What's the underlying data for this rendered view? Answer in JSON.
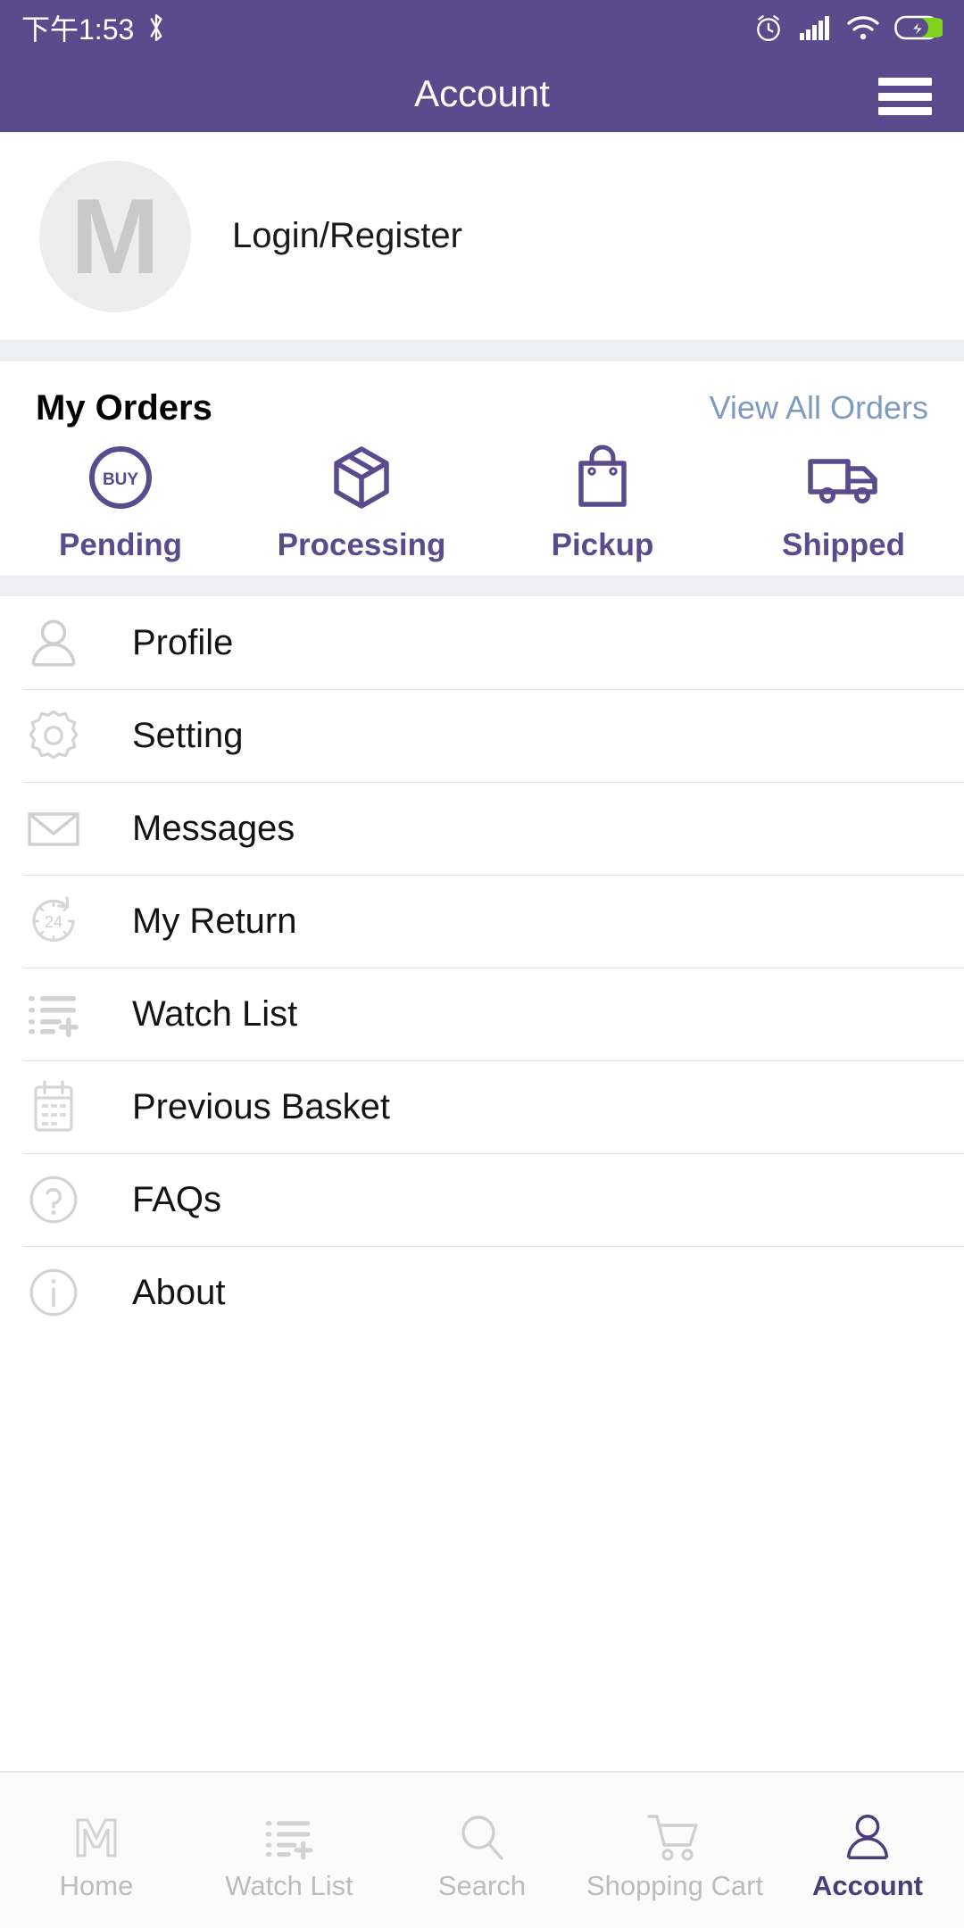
{
  "statusbar": {
    "time": "下午1:53",
    "icons": [
      "bluetooth-icon",
      "alarm-icon",
      "signal-icon",
      "wifi-icon",
      "battery-charging-icon"
    ]
  },
  "header": {
    "title": "Account",
    "menu_icon": "hamburger-menu-icon"
  },
  "profile": {
    "avatar_letter": "M",
    "login_label": "Login/Register"
  },
  "orders": {
    "title": "My Orders",
    "view_all_label": "View All Orders",
    "statuses": [
      {
        "label": "Pending",
        "icon": "buy-circle-icon"
      },
      {
        "label": "Processing",
        "icon": "package-box-icon"
      },
      {
        "label": "Pickup",
        "icon": "shopping-bag-icon"
      },
      {
        "label": "Shipped",
        "icon": "delivery-truck-icon"
      }
    ]
  },
  "menu": {
    "items": [
      {
        "label": "Profile",
        "icon": "person-icon"
      },
      {
        "label": "Setting",
        "icon": "gear-icon"
      },
      {
        "label": "Messages",
        "icon": "envelope-icon"
      },
      {
        "label": "My Return",
        "icon": "clock-24-icon"
      },
      {
        "label": "Watch List",
        "icon": "list-add-icon"
      },
      {
        "label": "Previous Basket",
        "icon": "calendar-icon"
      },
      {
        "label": "FAQs",
        "icon": "question-circle-icon"
      },
      {
        "label": "About",
        "icon": "info-circle-icon"
      }
    ]
  },
  "bottomnav": {
    "items": [
      {
        "label": "Home",
        "icon": "m-logo-icon",
        "active": false
      },
      {
        "label": "Watch List",
        "icon": "list-add-icon",
        "active": false
      },
      {
        "label": "Search",
        "icon": "search-icon",
        "active": false
      },
      {
        "label": "Shopping Cart",
        "icon": "cart-icon",
        "active": false
      },
      {
        "label": "Account",
        "icon": "person-icon",
        "active": true
      }
    ]
  },
  "colors": {
    "brand_purple": "#5a4b8c",
    "accent_blue": "#7e9ac0",
    "nav_inactive": "#bcbcbc",
    "nav_active": "#4b3d7a",
    "band_gray": "#eceef1"
  }
}
